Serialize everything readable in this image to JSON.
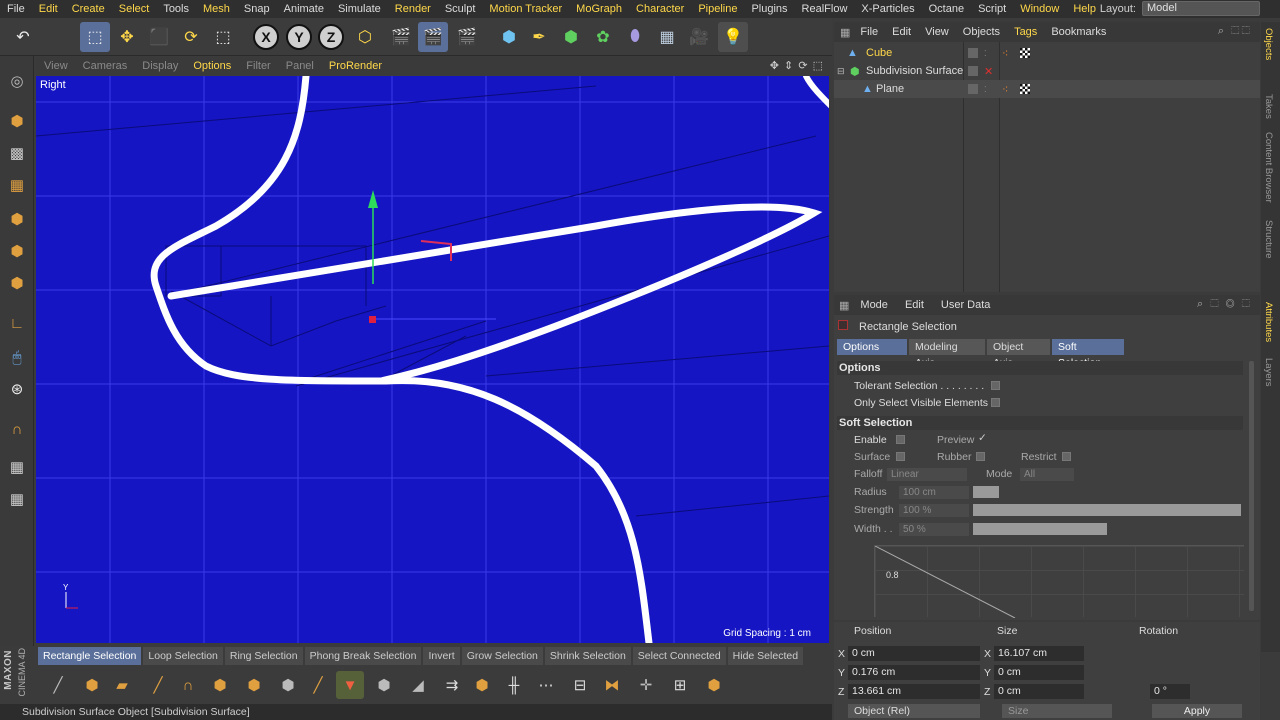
{
  "menubar": {
    "items": [
      "File",
      "Edit",
      "Create",
      "Select",
      "Tools",
      "Mesh",
      "Snap",
      "Animate",
      "Simulate",
      "Render",
      "Sculpt",
      "Motion Tracker",
      "MoGraph",
      "Character",
      "Pipeline",
      "Plugins",
      "RealFlow",
      "X-Particles",
      "Octane",
      "Script",
      "Window",
      "Help"
    ],
    "highlighted": [
      "Edit",
      "Create",
      "Select",
      "Mesh",
      "Render",
      "Motion Tracker",
      "MoGraph",
      "Character",
      "Pipeline",
      "Window",
      "Help"
    ],
    "layout_label": "Layout:",
    "layout_value": "Model"
  },
  "toolbar": {
    "axis_labels": [
      "X",
      "Y",
      "Z"
    ],
    "icons": [
      "undo-icon",
      "live-selection-icon",
      "move-icon",
      "scale-icon",
      "rotate-icon",
      "recent-tool-icon",
      "x-axis-icon",
      "y-axis-icon",
      "z-axis-icon",
      "coordinate-system-icon",
      "render-view-icon",
      "render-picture-viewer-icon",
      "render-settings-icon",
      "cube-icon",
      "pen-icon",
      "subdivision-icon",
      "array-icon",
      "deformer-icon",
      "floor-icon",
      "camera-icon",
      "light-icon"
    ]
  },
  "viewport": {
    "menu": [
      "View",
      "Cameras",
      "Display",
      "Options",
      "Filter",
      "Panel",
      "ProRender"
    ],
    "active_menu": "Options",
    "view_name": "Right",
    "grid_spacing": "Grid Spacing : 1 cm",
    "axis_y": "Y"
  },
  "selection_bar": {
    "items": [
      "Rectangle Selection",
      "Loop Selection",
      "Ring Selection",
      "Phong Break Selection",
      "Invert",
      "Grow Selection",
      "Shrink Selection",
      "Select Connected",
      "Hide Selected"
    ],
    "active": "Rectangle Selection"
  },
  "status": {
    "text": "Subdivision Surface Object [Subdivision Surface]"
  },
  "logo": {
    "line1": "MAXON",
    "line2": "CINEMA 4D"
  },
  "objects": {
    "menu": [
      "File",
      "Edit",
      "View",
      "Objects",
      "Tags",
      "Bookmarks"
    ],
    "active_menu": "Tags",
    "rows": [
      {
        "name": "Cube",
        "color": "#ffd84a"
      },
      {
        "name": "Subdivision Surface",
        "color": "#dddddd"
      },
      {
        "name": "Plane",
        "color": "#dddddd"
      }
    ]
  },
  "side_tabs": [
    "Objects",
    "Takes",
    "Content Browser",
    "Structure",
    "Attributes",
    "Layers"
  ],
  "attributes": {
    "menu": [
      "Mode",
      "Edit",
      "User Data"
    ],
    "title": "Rectangle Selection",
    "tabs": [
      "Options",
      "Modeling Axis",
      "Object Axis",
      "Soft Selection"
    ],
    "active_tabs": [
      "Options",
      "Soft Selection"
    ],
    "options_header": "Options",
    "tolerant_selection": "Tolerant Selection . . . . . . . .",
    "only_visible": "Only Select Visible Elements",
    "soft_header": "Soft Selection",
    "enable": "Enable",
    "preview": "Preview",
    "preview_check": "✓",
    "surface": "Surface",
    "rubber": "Rubber",
    "restrict": "Restrict",
    "falloff_label": "Falloff",
    "falloff_value": "Linear",
    "mode_label": "Mode",
    "mode_value": "All",
    "radius_label": "Radius",
    "radius_value": "100 cm",
    "strength_label": "Strength",
    "strength_value": "100 %",
    "width_label": "Width . .",
    "width_value": "50 %",
    "graph_tick": "0.8"
  },
  "coordinates": {
    "headers": [
      "Position",
      "Size",
      "Rotation"
    ],
    "axes": [
      "X",
      "Y",
      "Z"
    ],
    "position": [
      "0 cm",
      "0.176 cm",
      "13.661 cm"
    ],
    "size": [
      "16.107 cm",
      "0 cm",
      "0 cm"
    ],
    "rotation_visible": [
      "0 °"
    ],
    "coord_mode": "Object (Rel)",
    "size_mode": "Size",
    "apply": "Apply"
  }
}
